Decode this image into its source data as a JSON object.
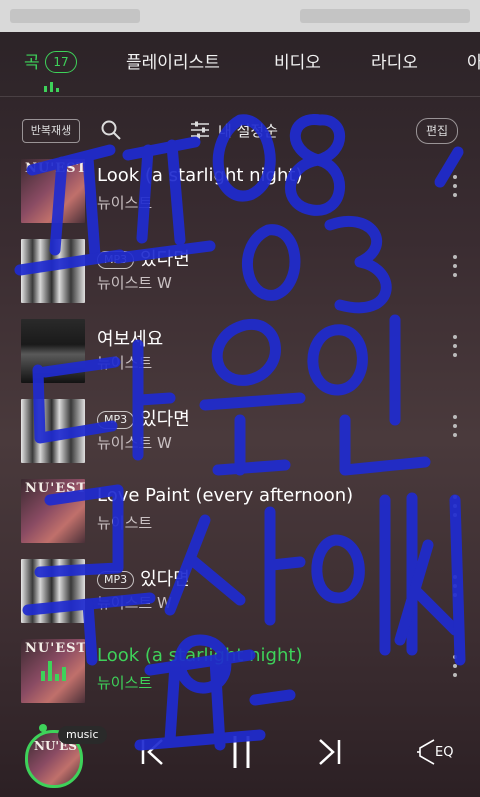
{
  "tabs": [
    {
      "label": "곡",
      "active": true,
      "count": "17"
    },
    {
      "label": "플레이리스트"
    },
    {
      "label": "비디오"
    },
    {
      "label": "라디오"
    },
    {
      "label": "아"
    }
  ],
  "toolbar": {
    "repeat_label": "반복재생",
    "settings_label": "내 설정순",
    "edit_label": "편집"
  },
  "songs": [
    {
      "title": "Look (a starlight night)",
      "artist": "뉴이스트",
      "mp3": false,
      "playing": false,
      "art": "NU'EST cover"
    },
    {
      "title": "있다면",
      "artist": "뉴이스트 W",
      "mp3": true,
      "mp3_label": "MP3",
      "playing": false,
      "art": "NU'EST W cover"
    },
    {
      "title": "여보세요",
      "artist": "뉴이스트",
      "mp3": false,
      "playing": false,
      "art": "group photo"
    },
    {
      "title": "있다면",
      "artist": "뉴이스트 W",
      "mp3": true,
      "mp3_label": "MP3",
      "playing": false,
      "art": "NU'EST W cover"
    },
    {
      "title": "Love Paint (every afternoon)",
      "artist": "뉴이스트",
      "mp3": false,
      "playing": false,
      "art": "NU'EST cover"
    },
    {
      "title": "있다면",
      "artist": "뉴이스트 W",
      "mp3": true,
      "mp3_label": "MP3",
      "playing": false,
      "art": "NU'EST W cover"
    },
    {
      "title": "Look (a starlight night)",
      "artist": "뉴이스트",
      "mp3": false,
      "playing": true,
      "art": "NU'EST cover"
    }
  ],
  "player": {
    "chip_label": "music",
    "eq_label": "EQ",
    "controls": [
      "previous-icon",
      "play-pause-icon",
      "next-icon",
      "eq-icon"
    ]
  },
  "colors": {
    "accent": "#3ed25a",
    "handwriting": "#1f2bd0"
  }
}
